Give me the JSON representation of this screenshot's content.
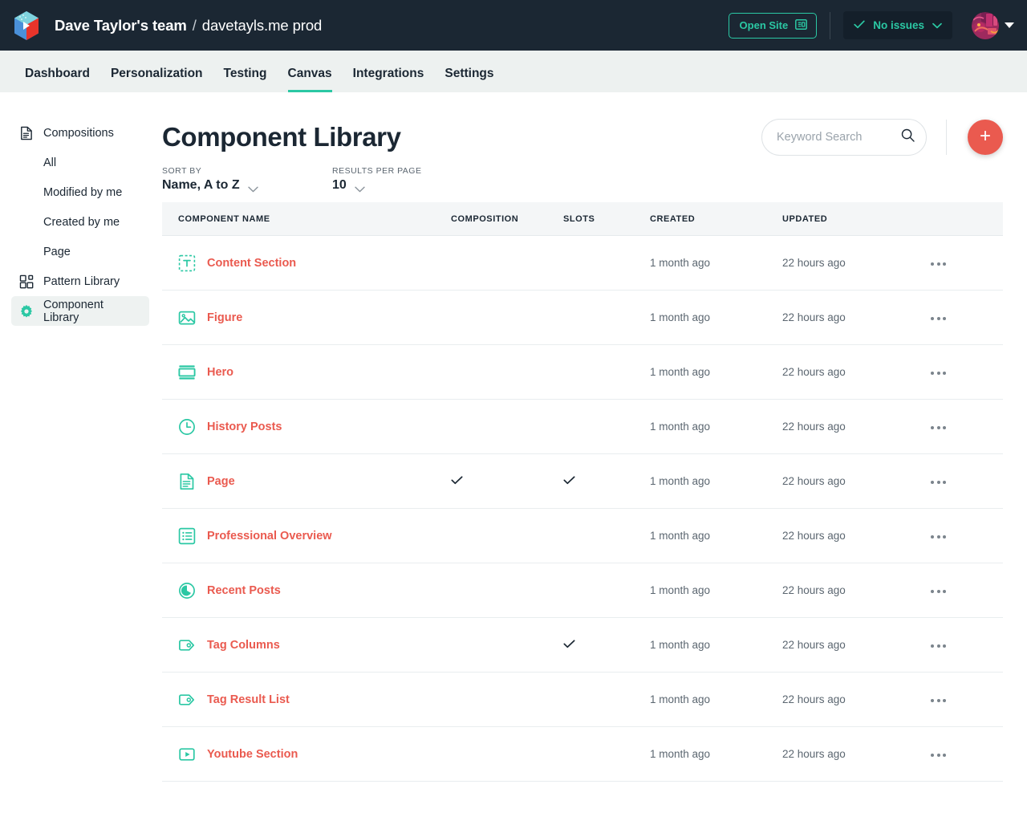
{
  "topbar": {
    "logo_icon": "uniform-cube-logo",
    "team_name": "Dave Taylor's team",
    "separator": "/",
    "site_name": "davetayls.me prod",
    "open_site_label": "Open Site",
    "open_site_icon": "external-window-icon",
    "issues_label": "No issues",
    "issues_check_icon": "check-icon",
    "issues_chevron_icon": "chevron-down-icon",
    "avatar_icon": "user-avatar",
    "avatar_caret_icon": "caret-down-icon",
    "accent_teal": "#2bc8a4",
    "background": "#1b2733"
  },
  "subnav": {
    "items": [
      {
        "label": "Dashboard",
        "active": false
      },
      {
        "label": "Personalization",
        "active": false
      },
      {
        "label": "Testing",
        "active": false
      },
      {
        "label": "Canvas",
        "active": true
      },
      {
        "label": "Integrations",
        "active": false
      },
      {
        "label": "Settings",
        "active": false
      }
    ],
    "active_underline_color": "#2bc8a4",
    "background": "#edf1f0"
  },
  "sidebar": {
    "items": [
      {
        "label": "Compositions",
        "icon": "document-icon",
        "sub": false,
        "selected": false
      },
      {
        "label": "All",
        "icon": null,
        "sub": true,
        "selected": false
      },
      {
        "label": "Modified by me",
        "icon": null,
        "sub": true,
        "selected": false
      },
      {
        "label": "Created by me",
        "icon": null,
        "sub": true,
        "selected": false
      },
      {
        "label": "Page",
        "icon": null,
        "sub": true,
        "selected": false
      },
      {
        "label": "Pattern Library",
        "icon": "pattern-blocks-icon",
        "sub": false,
        "selected": false
      },
      {
        "label": "Component Library",
        "icon": "gear-icon",
        "sub": false,
        "selected": true
      }
    ],
    "selected_background": "#eef2f1"
  },
  "main": {
    "title": "Component Library",
    "search": {
      "placeholder": "Keyword Search",
      "value": "",
      "icon": "search-icon"
    },
    "add_button": {
      "label": "+",
      "icon": "plus-icon",
      "color": "#ea5a4f"
    },
    "controls": {
      "sort_by_label": "SORT BY",
      "sort_by_value": "Name, A to Z",
      "sort_chevron_icon": "chevron-down-icon",
      "results_per_page_label": "RESULTS PER PAGE",
      "results_per_page_value": "10",
      "rpp_chevron_icon": "chevron-down-icon"
    },
    "table": {
      "columns": [
        "COMPONENT NAME",
        "COMPOSITION",
        "SLOTS",
        "CREATED",
        "UPDATED"
      ],
      "row_menu_icon": "ellipsis-icon",
      "check_icon": "check-icon",
      "link_color": "#ea5a4f",
      "icon_color": "#2bc8a4",
      "rows": [
        {
          "name": "Content Section",
          "icon": "text-box-dashed-icon",
          "composition": false,
          "slots": false,
          "created": "1 month ago",
          "updated": "22 hours ago"
        },
        {
          "name": "Figure",
          "icon": "image-icon",
          "composition": false,
          "slots": false,
          "created": "1 month ago",
          "updated": "22 hours ago"
        },
        {
          "name": "Hero",
          "icon": "hero-banner-icon",
          "composition": false,
          "slots": false,
          "created": "1 month ago",
          "updated": "22 hours ago"
        },
        {
          "name": "History Posts",
          "icon": "clock-icon",
          "composition": false,
          "slots": false,
          "created": "1 month ago",
          "updated": "22 hours ago"
        },
        {
          "name": "Page",
          "icon": "document-icon",
          "composition": true,
          "slots": true,
          "created": "1 month ago",
          "updated": "22 hours ago"
        },
        {
          "name": "Professional Overview",
          "icon": "list-box-icon",
          "composition": false,
          "slots": false,
          "created": "1 month ago",
          "updated": "22 hours ago"
        },
        {
          "name": "Recent Posts",
          "icon": "pie-chart-icon",
          "composition": false,
          "slots": false,
          "created": "1 month ago",
          "updated": "22 hours ago"
        },
        {
          "name": "Tag Columns",
          "icon": "tag-icon",
          "composition": false,
          "slots": true,
          "created": "1 month ago",
          "updated": "22 hours ago"
        },
        {
          "name": "Tag Result List",
          "icon": "tag-icon",
          "composition": false,
          "slots": false,
          "created": "1 month ago",
          "updated": "22 hours ago"
        },
        {
          "name": "Youtube Section",
          "icon": "video-play-icon",
          "composition": false,
          "slots": false,
          "created": "1 month ago",
          "updated": "22 hours ago"
        }
      ]
    }
  }
}
